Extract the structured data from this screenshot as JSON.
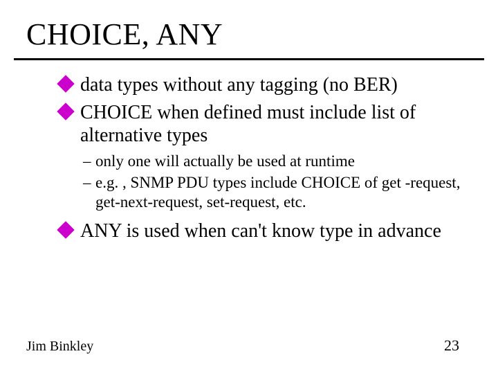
{
  "title": "CHOICE, ANY",
  "bullets": {
    "b1": "data types without any tagging (no BER)",
    "b2": "CHOICE when defined must include list of alternative types",
    "b2_sub1": "only one will actually be used at runtime",
    "b2_sub2": "e.g. , SNMP PDU types include CHOICE of get -request, get-next-request, set-request, etc.",
    "b3": "ANY is used when can't know type in advance"
  },
  "footer": {
    "author": "Jim Binkley",
    "page": "23"
  }
}
